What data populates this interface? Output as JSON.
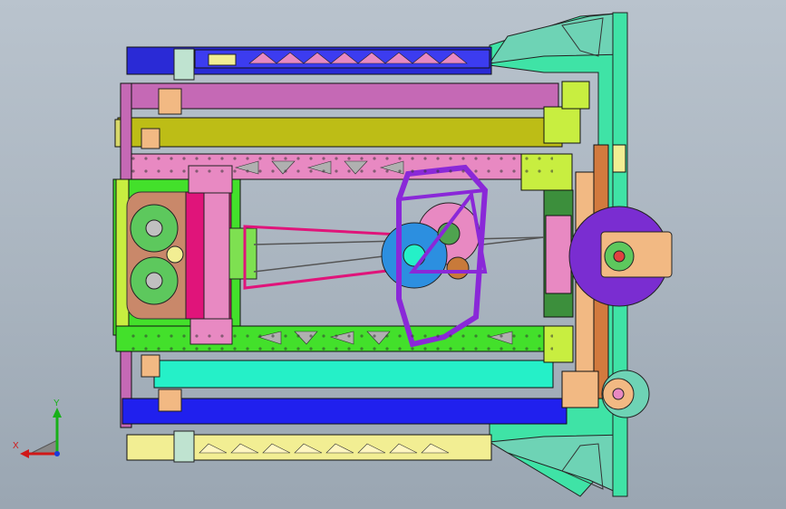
{
  "viewport": {
    "background_top": "#b9c3cd",
    "background_bottom": "#9aa6b2"
  },
  "model": {
    "colors": {
      "blue_rail": "#2a2ad6",
      "pink_rail": "#c569b5",
      "olive_rail": "#bdbd16",
      "pink_frame": "#e889c2",
      "green_frame": "#43e02b",
      "cyan_rail": "#25f0c8",
      "blue_rail_2": "#2020ee",
      "yellow_rail": "#f2ee93",
      "mint_plate": "#3fe3a6",
      "purple_plate": "#7a2dd1",
      "purple_gear": "#8a28d8",
      "blue_gear": "#2c8fe0",
      "orange_plate": "#d27a3e",
      "lime_bracket": "#c8ee40",
      "magenta_hub": "#e0147a",
      "peach_bracket": "#f2b983",
      "teal_plate": "#6ed3b5",
      "motor_green": "#7ee051"
    }
  },
  "axes": {
    "x_label": "X",
    "y_label": "Y",
    "x_color": "#d01818",
    "y_color": "#18b018",
    "z_color": "#1a3adc"
  }
}
